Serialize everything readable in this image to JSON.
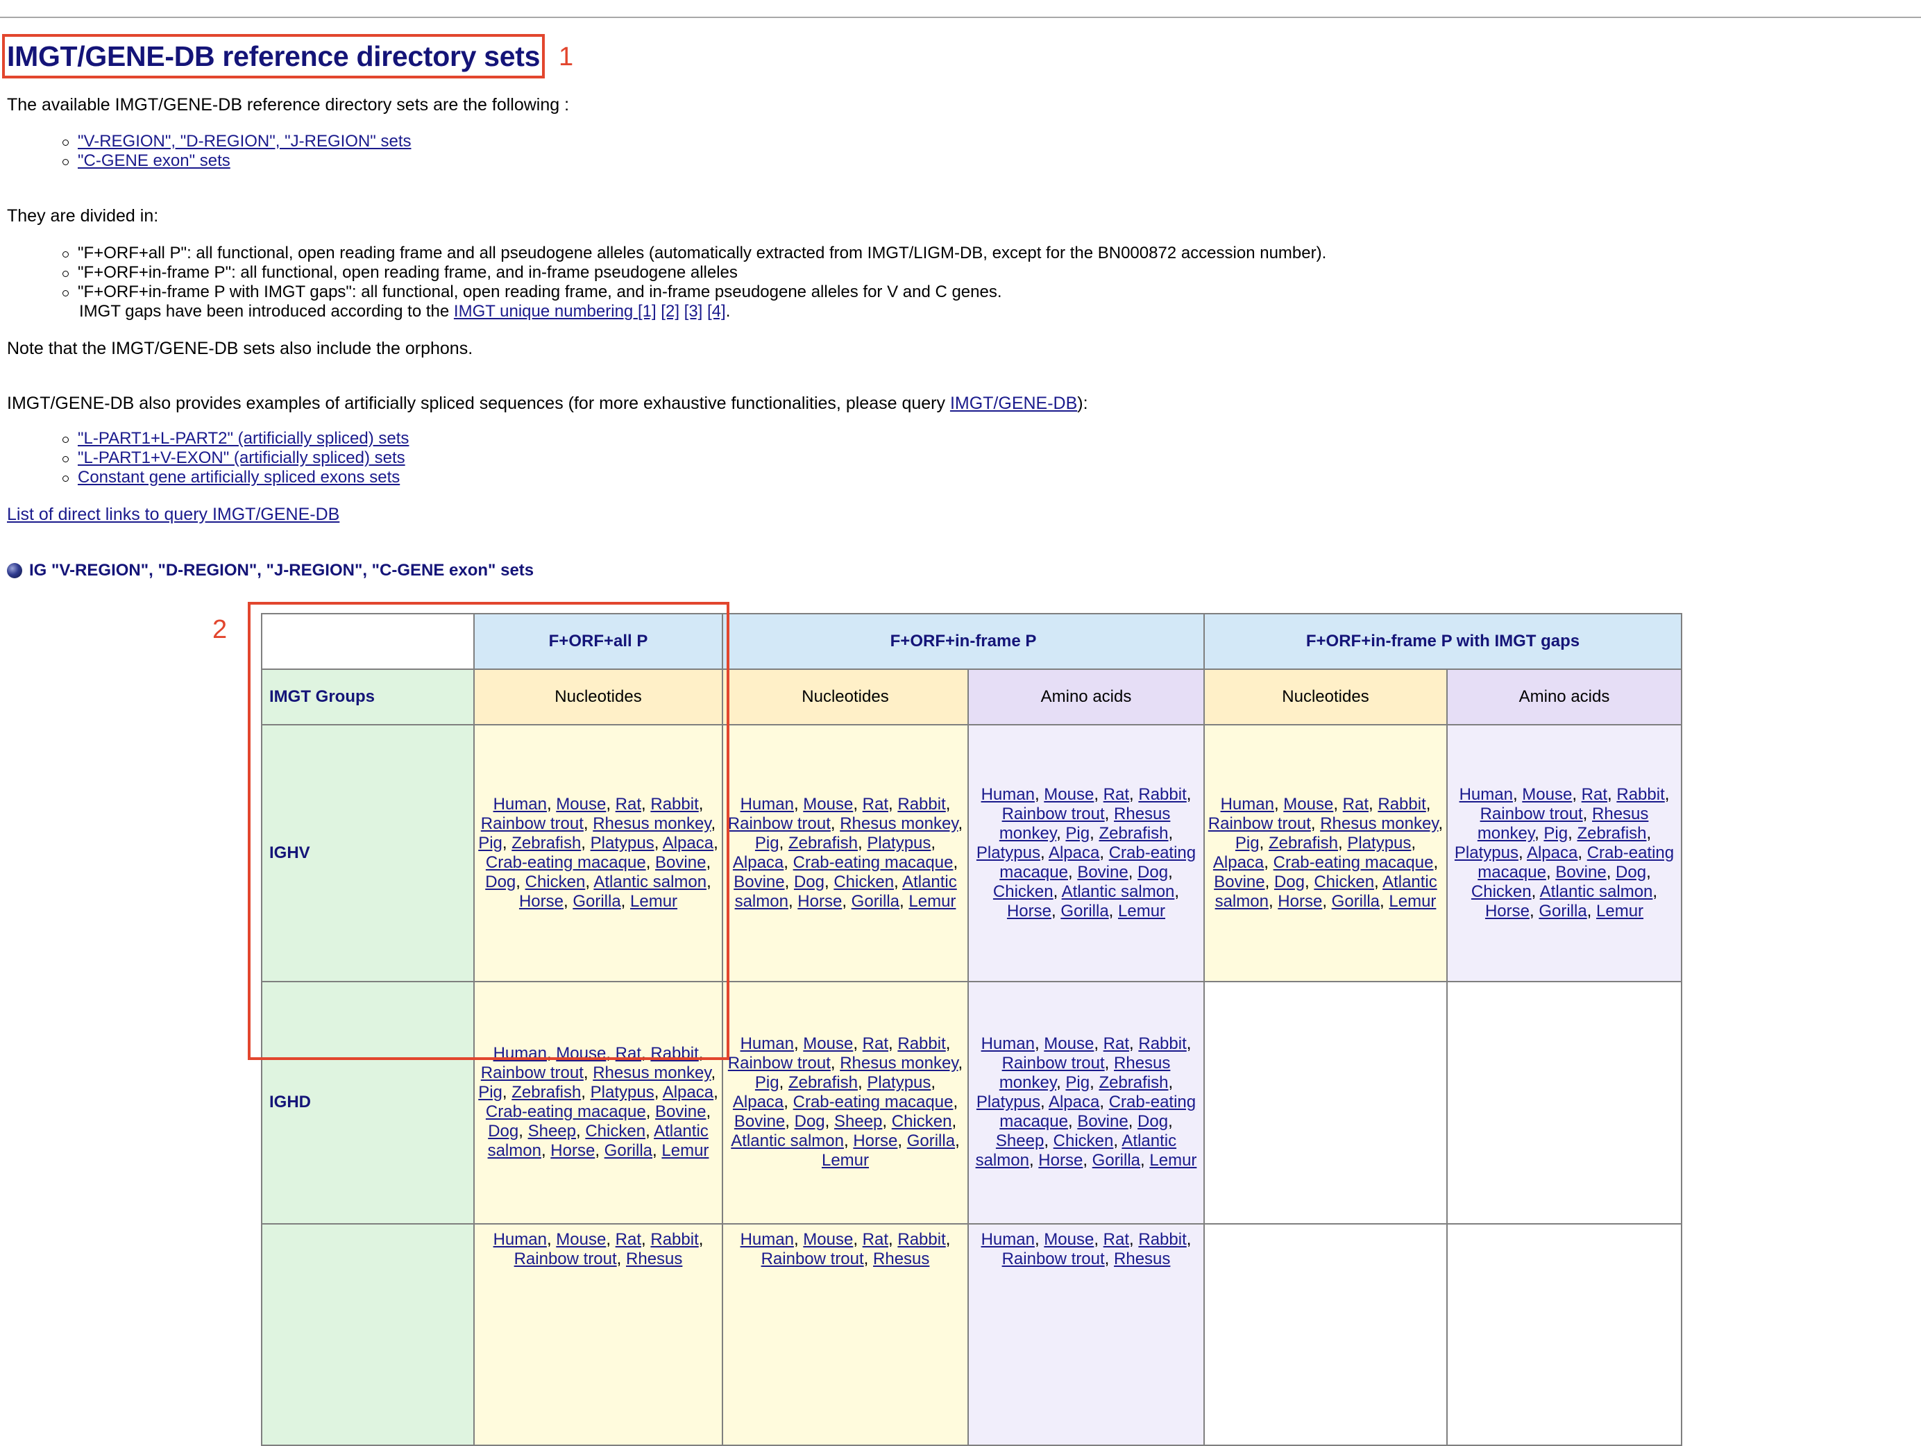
{
  "page_title": "IMGT/GENE-DB reference directory sets",
  "annotations": [
    "1",
    "2"
  ],
  "intro_text": "The available IMGT/GENE-DB reference directory sets are the following :",
  "set_links": [
    "\"V-REGION\", \"D-REGION\", \"J-REGION\" sets",
    "\"C-GENE exon\" sets"
  ],
  "divided_text": "They are divided in:",
  "divided_items": [
    "\"F+ORF+all P\": all functional, open reading frame and all pseudogene alleles (automatically extracted from IMGT/LIGM-DB, except for the BN000872 accession number).",
    "\"F+ORF+in-frame P\": all functional, open reading frame, and in-frame pseudogene alleles",
    "\"F+ORF+in-frame P with IMGT gaps\": all functional, open reading frame, and in-frame pseudogene alleles for V and C genes."
  ],
  "gaps_line": {
    "prefix": "IMGT gaps have been introduced according to the ",
    "link": "IMGT unique numbering ",
    "refs": [
      "[1]",
      "[2]",
      "[3]",
      "[4]"
    ],
    "suffix": "."
  },
  "note_text": "Note that the IMGT/GENE-DB sets also include the orphons.",
  "spliced_line": {
    "prefix": "IMGT/GENE-DB also provides examples of artificially spliced sequences (for more exhaustive functionalities, please query ",
    "link": "IMGT/GENE-DB",
    "suffix": "):"
  },
  "spliced_links": [
    "\"L-PART1+L-PART2\" (artificially spliced) sets",
    "\"L-PART1+V-EXON\" (artificially spliced) sets",
    "Constant gene artificially spliced exons sets"
  ],
  "direct_links_text": "List of direct links to query IMGT/GENE-DB",
  "section_title": "IG \"V-REGION\", \"D-REGION\", \"J-REGION\", \"C-GENE exon\" sets",
  "table": {
    "header_groups": [
      "F+ORF+all P",
      "F+ORF+in-frame P",
      "F+ORF+in-frame P with IMGT gaps"
    ],
    "row_groups_label": "IMGT Groups",
    "subheaders": [
      "Nucleotides",
      "Nucleotides",
      "Amino acids",
      "Nucleotides",
      "Amino acids"
    ],
    "rows": [
      {
        "label": "IGHV",
        "cells": [
          [
            "Human",
            "Mouse",
            "Rat",
            "Rabbit",
            "Rainbow trout",
            "Rhesus monkey",
            "Pig",
            "Zebrafish",
            "Platypus",
            "Alpaca",
            "Crab-eating macaque",
            "Bovine",
            "Dog",
            "Chicken",
            "Atlantic salmon",
            "Horse",
            "Gorilla",
            "Lemur"
          ],
          [
            "Human",
            "Mouse",
            "Rat",
            "Rabbit",
            "Rainbow trout",
            "Rhesus monkey",
            "Pig",
            "Zebrafish",
            "Platypus",
            "Alpaca",
            "Crab-eating macaque",
            "Bovine",
            "Dog",
            "Chicken",
            "Atlantic salmon",
            "Horse",
            "Gorilla",
            "Lemur"
          ],
          [
            "Human",
            "Mouse",
            "Rat",
            "Rabbit",
            "Rainbow trout",
            "Rhesus monkey",
            "Pig",
            "Zebrafish",
            "Platypus",
            "Alpaca",
            "Crab-eating macaque",
            "Bovine",
            "Dog",
            "Chicken",
            "Atlantic salmon",
            "Horse",
            "Gorilla",
            "Lemur"
          ],
          [
            "Human",
            "Mouse",
            "Rat",
            "Rabbit",
            "Rainbow trout",
            "Rhesus monkey",
            "Pig",
            "Zebrafish",
            "Platypus",
            "Alpaca",
            "Crab-eating macaque",
            "Bovine",
            "Dog",
            "Chicken",
            "Atlantic salmon",
            "Horse",
            "Gorilla",
            "Lemur"
          ],
          [
            "Human",
            "Mouse",
            "Rat",
            "Rabbit",
            "Rainbow trout",
            "Rhesus monkey",
            "Pig",
            "Zebrafish",
            "Platypus",
            "Alpaca",
            "Crab-eating macaque",
            "Bovine",
            "Dog",
            "Chicken",
            "Atlantic salmon",
            "Horse",
            "Gorilla",
            "Lemur"
          ]
        ]
      },
      {
        "label": "IGHD",
        "cells": [
          [
            "Human",
            "Mouse",
            "Rat",
            "Rabbit",
            "Rainbow trout",
            "Rhesus monkey",
            "Pig",
            "Zebrafish",
            "Platypus",
            "Alpaca",
            "Crab-eating macaque",
            "Bovine",
            "Dog",
            "Sheep",
            "Chicken",
            "Atlantic salmon",
            "Horse",
            "Gorilla",
            "Lemur"
          ],
          [
            "Human",
            "Mouse",
            "Rat",
            "Rabbit",
            "Rainbow trout",
            "Rhesus monkey",
            "Pig",
            "Zebrafish",
            "Platypus",
            "Alpaca",
            "Crab-eating macaque",
            "Bovine",
            "Dog",
            "Sheep",
            "Chicken",
            "Atlantic salmon",
            "Horse",
            "Gorilla",
            "Lemur"
          ],
          [
            "Human",
            "Mouse",
            "Rat",
            "Rabbit",
            "Rainbow trout",
            "Rhesus monkey",
            "Pig",
            "Zebrafish",
            "Platypus",
            "Alpaca",
            "Crab-eating macaque",
            "Bovine",
            "Dog",
            "Sheep",
            "Chicken",
            "Atlantic salmon",
            "Horse",
            "Gorilla",
            "Lemur"
          ],
          [],
          []
        ]
      },
      {
        "label": "",
        "cells": [
          [
            "Human",
            "Mouse",
            "Rat",
            "Rabbit",
            "Rainbow trout",
            "Rhesus"
          ],
          [
            "Human",
            "Mouse",
            "Rat",
            "Rabbit",
            "Rainbow trout",
            "Rhesus"
          ],
          [
            "Human",
            "Mouse",
            "Rat",
            "Rabbit",
            "Rainbow trout",
            "Rhesus"
          ],
          [],
          []
        ]
      }
    ]
  }
}
